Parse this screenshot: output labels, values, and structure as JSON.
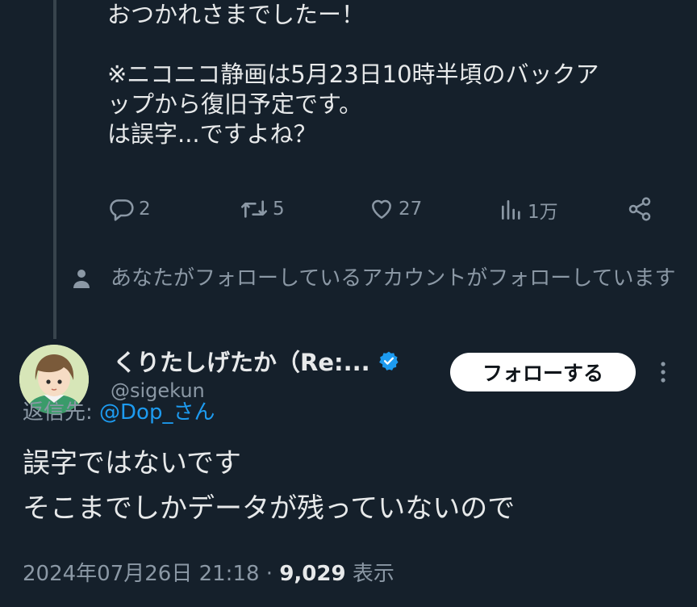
{
  "previous_tweet": {
    "lines": [
      "おつかれさまでしたー！",
      "",
      "※ニコニコ静画は5月23日10時半頃のバックア",
      "ップから復旧予定です。",
      "は誤字...ですよね？"
    ],
    "actions": {
      "replies": "2",
      "retweets": "5",
      "likes": "27",
      "views": "1万"
    }
  },
  "social_context": "あなたがフォローしているアカウントがフォローしています",
  "reply_tweet": {
    "author_name": "くりたしげたか（Re:...",
    "handle": "@sigekun",
    "follow_label": "フォローする",
    "reply_to_prefix": "返信先: ",
    "reply_to_user": "@Dop_さん",
    "lines": [
      "誤字ではないです",
      "そこまでしかデータが残っていないので"
    ],
    "timestamp": "2024年07月26日 21:18",
    "separator": "·",
    "view_count": "9,029",
    "view_label": "表示"
  },
  "colors": {
    "background": "#15202b",
    "text": "#e7e9ea",
    "muted": "#8b98a5",
    "accent": "#1d9bf0"
  },
  "icons": [
    "reply-icon",
    "retweet-icon",
    "like-icon",
    "views-icon",
    "share-icon",
    "person-icon",
    "verified-icon",
    "more-icon"
  ]
}
